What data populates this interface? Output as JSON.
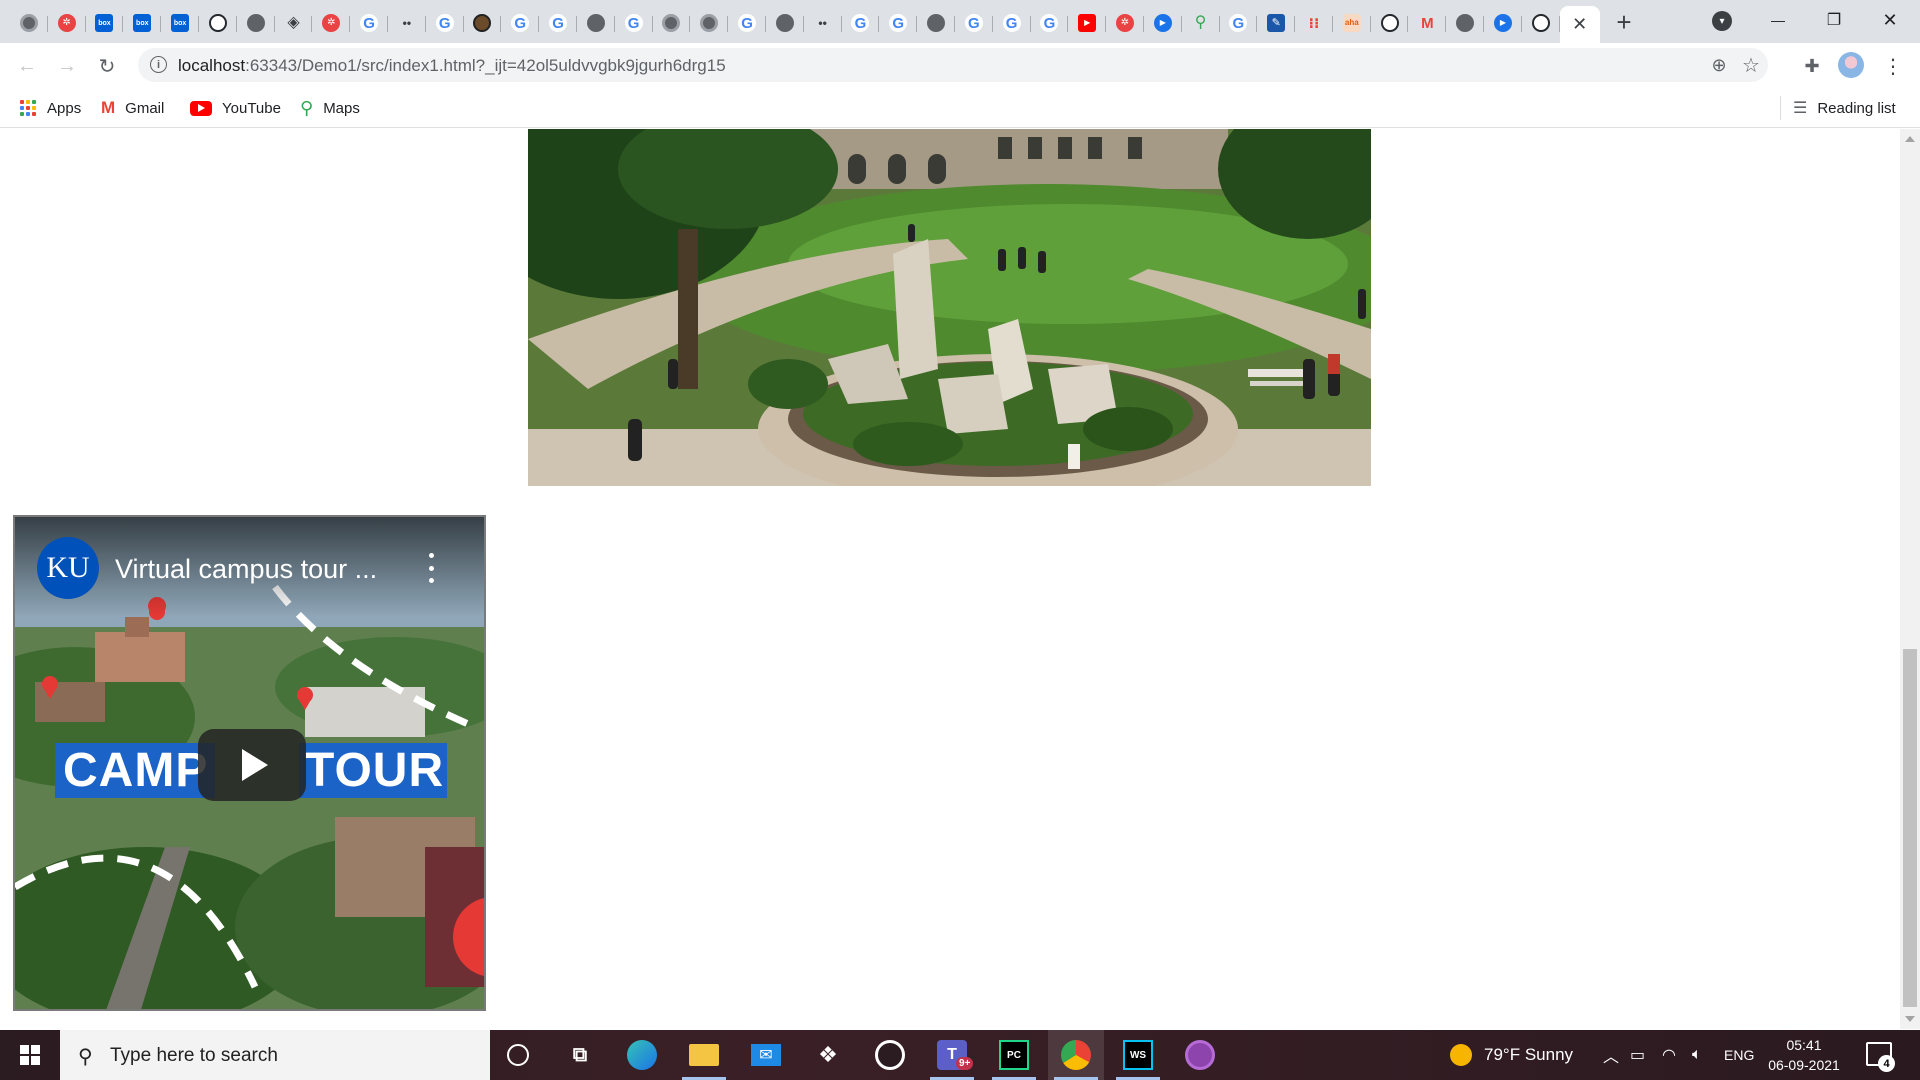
{
  "browser": {
    "tab_icons": [
      "chrome-icon",
      "settings-red-icon",
      "box-icon",
      "box-icon",
      "box-icon",
      "github-icon",
      "globe-icon",
      "diamond-icon",
      "settings-red-icon",
      "google-icon",
      "dots-icon",
      "google-icon",
      "avatar-icon",
      "google-icon",
      "google-icon",
      "globe-icon",
      "google-icon",
      "chrome-icon",
      "chrome-icon",
      "google-icon",
      "globe-icon",
      "dots-icon",
      "google-icon",
      "google-icon",
      "globe-icon",
      "google-icon",
      "google-icon",
      "google-icon",
      "youtube-icon",
      "settings-red-icon",
      "play-icon",
      "maps-icon",
      "google-icon",
      "edit-icon",
      "apps-icon",
      "aha-icon",
      "github-icon",
      "gmail-icon",
      "globe-icon",
      "play-icon",
      "github-icon"
    ],
    "active_tab_close": "✕",
    "new_tab": "+",
    "window_controls": {
      "minimize": "—",
      "maximize": "❐",
      "close": "✕"
    }
  },
  "toolbar": {
    "back": "←",
    "forward": "→",
    "reload": "↻",
    "url_host": "localhost",
    "url_rest": ":63343/Demo1/src/index1.html?_ijt=42ol5uldvvgbk9jgurh6drg15",
    "zoom_icon": "⊕",
    "star_icon": "☆",
    "extensions_icon": "✚",
    "menu_icon": "⋮"
  },
  "bookmarks": {
    "items": [
      {
        "label": "Apps",
        "icon": "apps-icon"
      },
      {
        "label": "Gmail",
        "icon": "gmail-icon"
      },
      {
        "label": "YouTube",
        "icon": "youtube-icon"
      },
      {
        "label": "Maps",
        "icon": "maps-icon"
      }
    ],
    "reading_list": "Reading list"
  },
  "page": {
    "video": {
      "logo": "KU",
      "title": "Virtual campus tour ...",
      "banner_left": "CAMP",
      "banner_right": "TOUR"
    }
  },
  "taskbar": {
    "search_placeholder": "Type here to search",
    "apps": [
      "cortana-icon",
      "task-view-icon",
      "edge-icon",
      "file-explorer-icon",
      "mail-icon",
      "dropbox-icon",
      "github-desktop-icon",
      "teams-icon",
      "pycharm-icon",
      "chrome-icon",
      "webstorm-icon",
      "github-icon"
    ],
    "teams_badge": "9+",
    "weather": "79°F  Sunny",
    "language": "ENG",
    "time": "05:41",
    "date": "06-09-2021",
    "notifications": "4"
  },
  "colors": {
    "tabstrip_bg": "#dee1e6",
    "ku_blue": "#0051ba",
    "banner_blue": "#1c63c7"
  }
}
